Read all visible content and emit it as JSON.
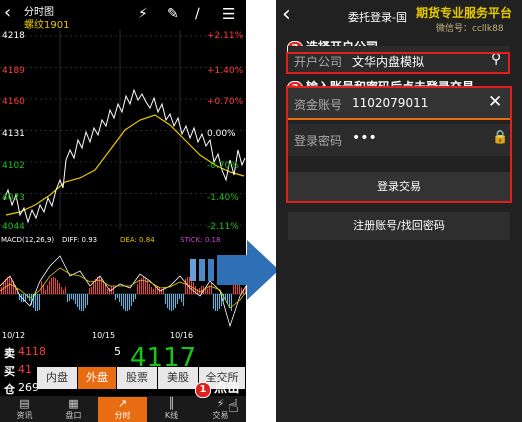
{
  "left_phone": {
    "header": {
      "title": "分时图",
      "symbol": "螺纹1901",
      "back_icon": "chevron-left-icon",
      "flash_icon": "lightning-icon",
      "draw_icon": "pen-icon",
      "menu_icon": "list-icon"
    },
    "price_axis": [
      "4218",
      "4189",
      "4160",
      "4131",
      "4102",
      "4073",
      "4044"
    ],
    "percent_axis": [
      "+2.11%",
      "+1.40%",
      "+0.70%",
      "0.00%",
      "-0.70%",
      "-1.40%",
      "-2.11%"
    ],
    "macd": {
      "title": "MACD(12,26,9)",
      "diff": "DIFF: 0.93",
      "dea": "DEA: 0.84",
      "stick": "STICK: 0.18"
    },
    "date_labels": [
      "10/12",
      "10/15",
      "10/16"
    ],
    "quote": {
      "sell_label": "卖",
      "sell_price": "4118",
      "sell_vol": "5",
      "buy_label": "买",
      "buy_price": "41",
      "hold_label": "仓",
      "hold_val": "269",
      "last_price": "4117"
    },
    "market_tabs": [
      "内盘",
      "外盘",
      "股票",
      "美股",
      "全交所"
    ],
    "bottom_tabs": [
      {
        "label": "资讯",
        "icon": "news-icon"
      },
      {
        "label": "盘口",
        "icon": "orderbook-icon"
      },
      {
        "label": "分时",
        "icon": "line-chart-icon"
      },
      {
        "label": "K线",
        "icon": "candlestick-icon"
      },
      {
        "label": "交易",
        "icon": "lightning-icon"
      }
    ],
    "annotation_1": "点击",
    "annotation_1_num": "1",
    "colors": {
      "accent": "#e86d12",
      "up": "#ff3a3a",
      "down": "#18c418",
      "price_line": "#ffffff",
      "avg_line": "#e6c800"
    }
  },
  "right_phone": {
    "header": {
      "title": "委托登录-国",
      "back_icon": "chevron-left-icon"
    },
    "watermark": {
      "line1": "期货专业服务平台",
      "line2": "微信号：ccllk88"
    },
    "company_field": {
      "label": "开户公司",
      "value": "文华内盘模拟",
      "icon": "search-icon"
    },
    "account_field": {
      "label": "资金账号",
      "value": "1102079011",
      "icon": "close-icon"
    },
    "password_field": {
      "label": "登录密码",
      "value": "•••",
      "icon": "lock-icon"
    },
    "login_button": "登录交易",
    "register_link": "注册账号/找回密码",
    "annotation_2": "选择开户公司",
    "annotation_2_num": "2",
    "annotation_3": "输入账号和密码后点击登录交易",
    "annotation_3_num": "3"
  },
  "arrow_icon": "right-arrow-icon"
}
